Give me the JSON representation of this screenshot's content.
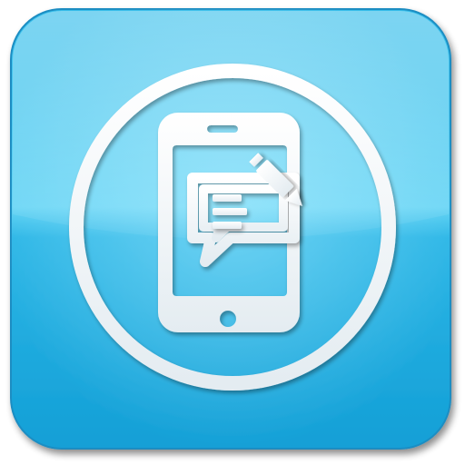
{
  "app_icon": {
    "icon": "smartphone-message-edit-icon",
    "description_icons": [
      "ring-icon",
      "smartphone-icon",
      "speech-bubble-icon",
      "text-lines-icon",
      "pencil-icon"
    ],
    "colors": {
      "tile_top": "#3fc6ef",
      "tile_mid": "#5fd4f5",
      "tile_bottom": "#1aa8da",
      "tile_border": "#1d8fc4",
      "glyph": "#ffffff",
      "glyph_shade": "#cfdbe2"
    }
  }
}
